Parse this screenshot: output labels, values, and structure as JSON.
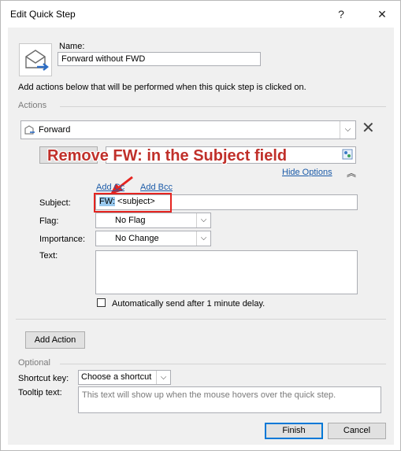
{
  "window": {
    "title": "Edit Quick Step"
  },
  "name": {
    "label": "Name:",
    "value": "Forward without FWD"
  },
  "description": "Add actions below that will be performed when this quick step is clicked on.",
  "actions": {
    "section_label": "Actions",
    "action_value": "Forward"
  },
  "to": {
    "button_label": "To..."
  },
  "annotation": {
    "text": "Remove FW: in the Subject field"
  },
  "hide_options": "Hide Options",
  "add_cc": "Add Cc",
  "add_bcc": "Add Bcc",
  "subject": {
    "label": "Subject:",
    "selected_text": "FW:",
    "rest_text": " <subject>"
  },
  "flag": {
    "label": "Flag:",
    "value": "No Flag"
  },
  "importance": {
    "label": "Importance:",
    "value": "No Change"
  },
  "text": {
    "label": "Text:"
  },
  "auto_send": {
    "label": "Automatically send after 1 minute delay."
  },
  "add_action": "Add Action",
  "optional": {
    "section_label": "Optional"
  },
  "shortcut": {
    "label": "Shortcut key:",
    "value": "Choose a shortcut"
  },
  "tooltip": {
    "label": "Tooltip text:",
    "placeholder": "This text will show up when the mouse hovers over the quick step."
  },
  "buttons": {
    "finish": "Finish",
    "cancel": "Cancel"
  },
  "icons": [
    "help-icon",
    "close-icon",
    "envelope-forward-icon",
    "chevron-down-icon",
    "delete-icon",
    "address-book-icon",
    "collapse-icon"
  ]
}
